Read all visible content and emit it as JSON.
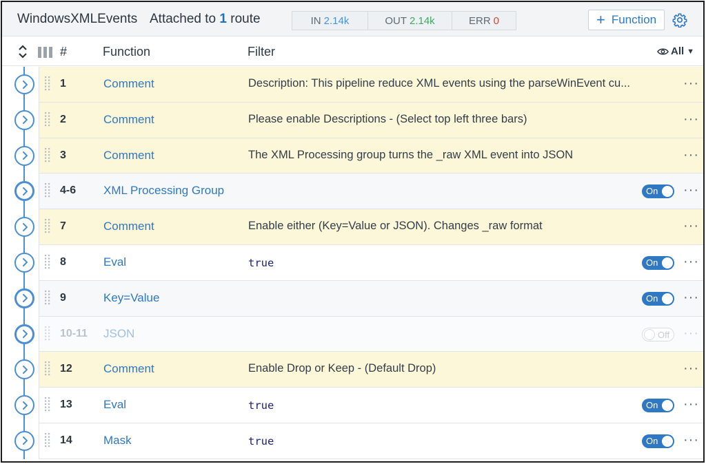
{
  "header": {
    "pipeline_name": "WindowsXMLEvents",
    "attached_prefix": "Attached to",
    "attached_count": "1",
    "attached_suffix": "route",
    "stats": {
      "in_label": "IN",
      "in_value": "2.14k",
      "out_label": "OUT",
      "out_value": "2.14k",
      "err_label": "ERR",
      "err_value": "0"
    },
    "add_function_label": "Function",
    "icons": {
      "add": "plus-icon",
      "settings": "gear-icon"
    }
  },
  "columns": {
    "number": "#",
    "function": "Function",
    "filter": "Filter",
    "view_filter": "All",
    "icons": {
      "collapse": "expand-collapse-icon",
      "columns": "column-bars-icon",
      "view": "eye-icon"
    }
  },
  "rows": [
    {
      "num": "1",
      "function": "Comment",
      "filter": "Description: This pipeline reduce XML events using the parseWinEvent cu...",
      "kind": "comment",
      "code": false,
      "toggle": null
    },
    {
      "num": "2",
      "function": "Comment",
      "filter": "Please enable Descriptions - (Select top left three bars)",
      "kind": "comment",
      "code": false,
      "toggle": null
    },
    {
      "num": "3",
      "function": "Comment",
      "filter": "The XML Processing group turns the _raw XML event into JSON",
      "kind": "comment",
      "code": false,
      "toggle": null
    },
    {
      "num": "4-6",
      "function": "XML Processing Group",
      "filter": "",
      "kind": "group",
      "code": false,
      "toggle": "On"
    },
    {
      "num": "7",
      "function": "Comment",
      "filter": "Enable either (Key=Value or JSON). Changes _raw format",
      "kind": "comment",
      "code": false,
      "toggle": null
    },
    {
      "num": "8",
      "function": "Eval",
      "filter": "true",
      "kind": "plain",
      "code": true,
      "toggle": "On"
    },
    {
      "num": "9",
      "function": "Key=Value",
      "filter": "",
      "kind": "group",
      "code": false,
      "toggle": "On"
    },
    {
      "num": "10-11",
      "function": "JSON",
      "filter": "",
      "kind": "disabled",
      "code": false,
      "toggle": "Off"
    },
    {
      "num": "12",
      "function": "Comment",
      "filter": "Enable Drop or Keep - (Default Drop)",
      "kind": "comment",
      "code": false,
      "toggle": null
    },
    {
      "num": "13",
      "function": "Eval",
      "filter": "true",
      "kind": "plain",
      "code": true,
      "toggle": "On"
    },
    {
      "num": "14",
      "function": "Mask",
      "filter": "true",
      "kind": "plain",
      "code": true,
      "toggle": "On"
    }
  ],
  "more_label": "···",
  "colors": {
    "accent": "#2f78c4",
    "comment_bg": "#fcf7d9",
    "in": "#4a90d9",
    "out": "#41a85f",
    "err": "#d9443a"
  }
}
